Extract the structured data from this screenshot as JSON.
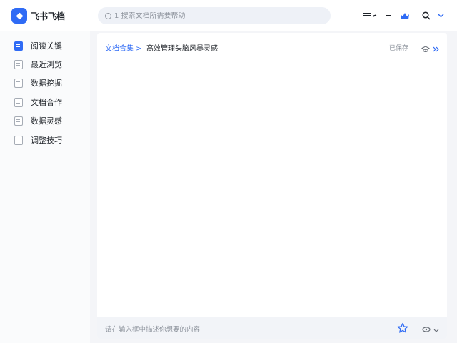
{
  "app": {
    "title": "飞书飞档",
    "logo_icon": "feishu-logo-icon",
    "accent": "#2f6bf5"
  },
  "header": {
    "search": {
      "placeholder": "1 搜索文档所需要帮助",
      "icon": "search-icon"
    },
    "icons": [
      "menu-icon",
      "minus-icon",
      "crown-icon",
      "search-icon",
      "chevron-down-icon"
    ]
  },
  "sidebar": {
    "items": [
      {
        "label": "阅读关键",
        "active": true
      },
      {
        "label": "最近浏览",
        "active": false
      },
      {
        "label": "数据挖掘",
        "active": false
      },
      {
        "label": "文档合作",
        "active": false
      },
      {
        "label": "数据灵感",
        "active": false
      },
      {
        "label": "调整技巧",
        "active": false
      }
    ]
  },
  "main": {
    "tag_label": "文档合集 >",
    "doc_title": "高效管理头脑风暴灵感",
    "status": "已保存",
    "header_icons": [
      "graduation-cap-icon",
      "double-chevron-right-icon"
    ],
    "footer": {
      "placeholder": "请在输入框中描述你想要的内容",
      "icons": [
        "star-icon",
        "eye-icon",
        "chevron-down-icon"
      ]
    }
  }
}
